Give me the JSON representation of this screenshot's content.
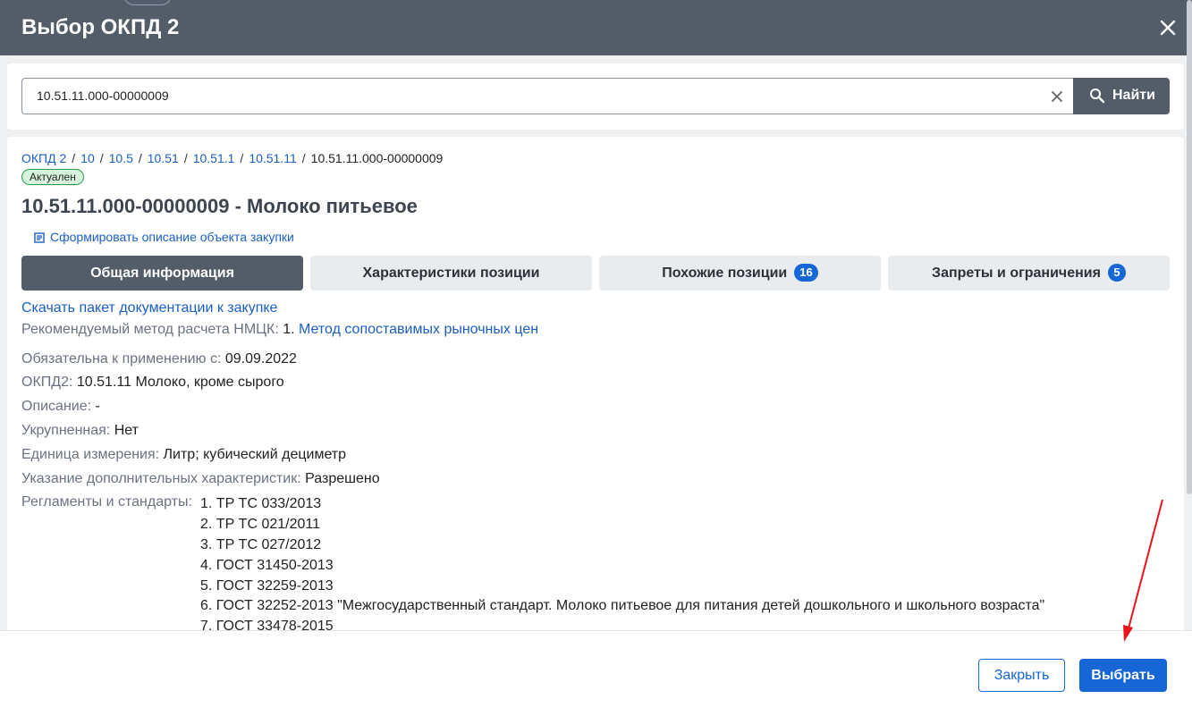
{
  "dialog": {
    "title": "Выбор ОКПД 2"
  },
  "search": {
    "value": "10.51.11.000-00000009",
    "button_label": "Найти"
  },
  "breadcrumb": {
    "items": [
      "ОКПД 2",
      "10",
      "10.5",
      "10.51",
      "10.51.1",
      "10.51.11"
    ],
    "current": "10.51.11.000-00000009",
    "separator": "/"
  },
  "status": {
    "label": "Актуален"
  },
  "item": {
    "title": "10.51.11.000-00000009 - Молоко питьевое",
    "generate_link": "Сформировать описание объекта закупки"
  },
  "tabs": [
    {
      "label": "Общая информация",
      "count": ""
    },
    {
      "label": "Характеристики позиции",
      "count": ""
    },
    {
      "label": "Похожие позиции",
      "count": "16"
    },
    {
      "label": "Запреты и ограничения",
      "count": "5"
    }
  ],
  "info": {
    "download_link": "Скачать пакет документации к закупке",
    "method_label": "Рекомендуемый метод расчета НМЦК:",
    "method_num": "1.",
    "method_value": "Метод сопоставимых рыночных цен",
    "fields": [
      {
        "label": "Обязательна к применению с:",
        "value": "09.09.2022"
      },
      {
        "label": "ОКПД2:",
        "value": "10.51.11 Молоко, кроме сырого"
      },
      {
        "label": "Описание:",
        "value": "-"
      },
      {
        "label": "Укрупненная:",
        "value": "Нет"
      },
      {
        "label": "Единица измерения:",
        "value": "Литр; кубический дециметр"
      },
      {
        "label": "Указание дополнительных характеристик:",
        "value": "Разрешено"
      }
    ],
    "standards_label": "Регламенты и стандарты:",
    "standards": [
      "1. ТР ТС 033/2013",
      "2. ТР ТС 021/2011",
      "3. ТР ТС 027/2012",
      "4. ГОСТ 31450-2013",
      "5. ГОСТ 32259-2013",
      "6. ГОСТ 32252-2013 \"Межгосударственный стандарт. Молоко питьевое для питания детей дошкольного и школьного возраста\"",
      "7. ГОСТ 33478-2015"
    ]
  },
  "footer": {
    "close_label": "Закрыть",
    "select_label": "Выбрать"
  },
  "colors": {
    "header": "#535c69",
    "accent": "#1766d6",
    "link": "#1b5fc1",
    "annotation_arrow": "#e8141b"
  }
}
